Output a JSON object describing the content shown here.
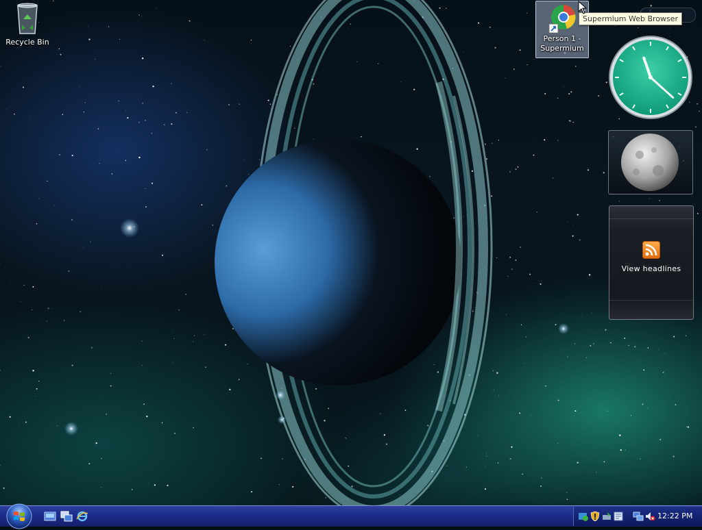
{
  "desktop": {
    "icons": [
      {
        "label": "Recycle Bin"
      },
      {
        "label_line1": "Person 1 -",
        "label_line2": "Supermium"
      }
    ],
    "tooltip": "Supermium Web Browser"
  },
  "gadgets": {
    "clock": {
      "hour": 11,
      "minute": 22
    },
    "feed": {
      "label": "View headlines"
    }
  },
  "taskbar": {
    "clock": "12:22 PM"
  },
  "colors": {
    "taskbar": "#1c2c8c",
    "clock_face": "#1fb58e",
    "rss_orange": "#f08a24"
  }
}
